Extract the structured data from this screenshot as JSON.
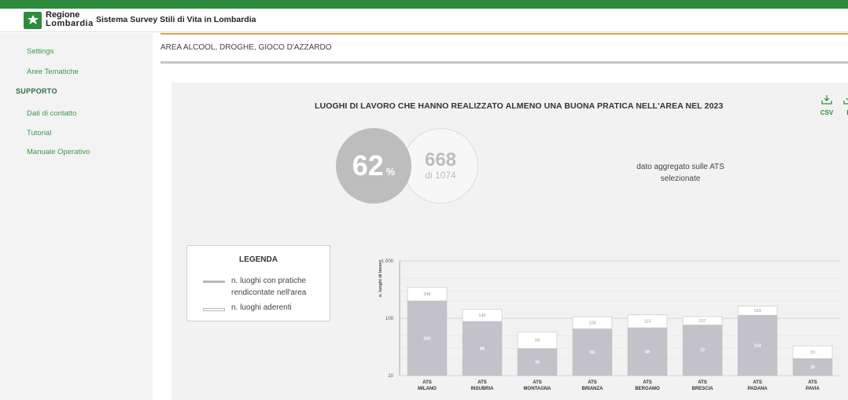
{
  "header": {
    "logo_line1": "Regione",
    "logo_line2": "Lombardia",
    "app_title": "Sistema Survey Stili di Vita in Lombardia"
  },
  "sidebar": {
    "items": [
      {
        "label": "Settings"
      },
      {
        "label": "Aree Tematiche"
      }
    ],
    "section": "SUPPORTO",
    "support_items": [
      {
        "label": "Dati di contatto"
      },
      {
        "label": "Tutorial"
      },
      {
        "label": "Manuale Operativo"
      }
    ]
  },
  "main": {
    "area_title": "AREA ALCOOL, DROGHE, GIOCO D'AZZARDO",
    "panel_title": "LUOGHI DI LAVORO CHE HANNO REALIZZATO ALMENO UNA BUONA PRATICA NELL'AREA NEL 2023",
    "downloads": [
      {
        "label": "CSV",
        "icon": "download-icon"
      },
      {
        "label": "P",
        "icon": "download-icon"
      }
    ],
    "percentage": "62",
    "percent_sign": "%",
    "count": "668",
    "count_sub": "di 1074",
    "aggregate_note_line1": "dato aggregato sulle ATS",
    "aggregate_note_line2": "selezionate"
  },
  "legend": {
    "title": "LEGENDA",
    "item1_line1": "n. luoghi con pratiche",
    "item1_line2": "rendicontate nell'area",
    "item2": "n. luoghi aderenti"
  },
  "colors": {
    "brand_green": "#2e8b3c",
    "accent_orange": "#e8a04a",
    "bar_gray": "#c2c2c8",
    "bar_white": "#ffffff"
  },
  "chart_data": {
    "type": "bar",
    "ylabel": "n. luoghi di lavoro",
    "yscale": "log",
    "ylim": [
      10,
      1000
    ],
    "yticks": [
      "1.000",
      "100",
      "10"
    ],
    "categories": [
      [
        "ATS",
        "MILANO"
      ],
      [
        "ATS",
        "INSUBRIA"
      ],
      [
        "ATS",
        "MONTAGNA"
      ],
      [
        "ATS",
        "BRIANZA"
      ],
      [
        "ATS",
        "BERGAMO"
      ],
      [
        "ATS",
        "BRESCIA"
      ],
      [
        "ATS",
        "PADANA"
      ],
      [
        "ATS",
        "PAVIA"
      ]
    ],
    "series": [
      {
        "name": "n. luoghi aderenti",
        "values": [
          348,
          143,
          58,
          106,
          115,
          107,
          163,
          33
        ]
      },
      {
        "name": "n. luoghi con pratiche rendicontate nell'area",
        "values": [
          203,
          89,
          30,
          66,
          69,
          77,
          114,
          20
        ]
      }
    ]
  }
}
